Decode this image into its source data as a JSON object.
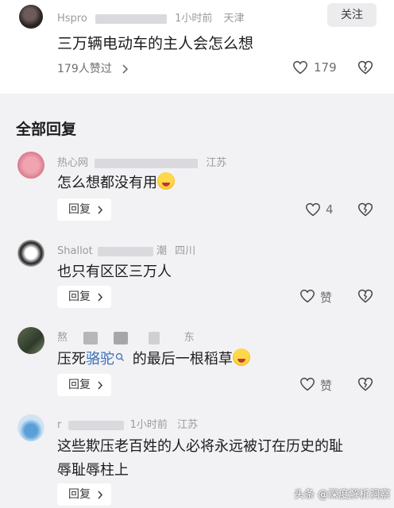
{
  "top_comment": {
    "username": "Hspro",
    "time": "1小时前",
    "location": "天津",
    "follow_label": "关注",
    "text": "三万辆电动车的主人会怎么想",
    "likes_line": "179人赞过",
    "like_count": "179"
  },
  "section_title": "全部回复",
  "replies": [
    {
      "username": "热心网",
      "location": "江苏",
      "text": "怎么想都没有用",
      "reply_label": "回复",
      "like_count": "4"
    },
    {
      "username": "Shallot",
      "time_location_suffix": "潮",
      "location": "四川",
      "text": "也只有区区三万人",
      "reply_label": "回复",
      "like_count": "赞"
    },
    {
      "username": "熬",
      "location_suffix": "东",
      "text_prefix": "压死",
      "link_text": "骆驼",
      "text_suffix": "的最后一根稻草",
      "reply_label": "回复",
      "like_count": "赞"
    },
    {
      "username": "r",
      "time": "1小时前",
      "location": "江苏",
      "text_line1": "这些欺压老百姓的人必将永远被订在历史的耻",
      "text_line2": "辱耻辱柱上",
      "reply_label": "回复"
    }
  ],
  "watermark": "头条 @深度解析洞察",
  "icons": [
    "heart-icon",
    "dislike-icon",
    "chevron-right-icon",
    "search-icon",
    "laughing-emoji"
  ]
}
